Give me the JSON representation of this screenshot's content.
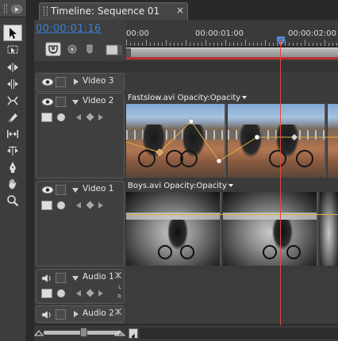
{
  "timeline": {
    "tab_title": "Timeline: Sequence 01",
    "close_glyph": "×",
    "timecode": "00:00:01:16"
  },
  "ruler": {
    "labels": [
      "00:00",
      "00:00:01:00",
      "00:00:02:00"
    ]
  },
  "tracks": {
    "video3": {
      "name": "Video 3"
    },
    "video2": {
      "name": "Video 2",
      "clip_label": "Fastslow.avi  Opacity:Opacity"
    },
    "video1": {
      "name": "Video 1",
      "clip_label": "Boys.avi  Opacity:Opacity"
    },
    "audio1": {
      "name": "Audio 1",
      "l": "L",
      "r": "R"
    },
    "audio2": {
      "name": "Audio 2"
    }
  },
  "tools": [
    "selection-tool",
    "track-select-tool",
    "ripple-edit-tool",
    "rolling-edit-tool",
    "rate-stretch-tool",
    "razor-tool",
    "slip-tool",
    "slide-tool",
    "pen-tool",
    "hand-tool",
    "zoom-tool"
  ],
  "colors": {
    "accent_timecode": "#3a7fd5",
    "playhead": "#e04a3a",
    "opacity_line": "#e0b03a"
  }
}
